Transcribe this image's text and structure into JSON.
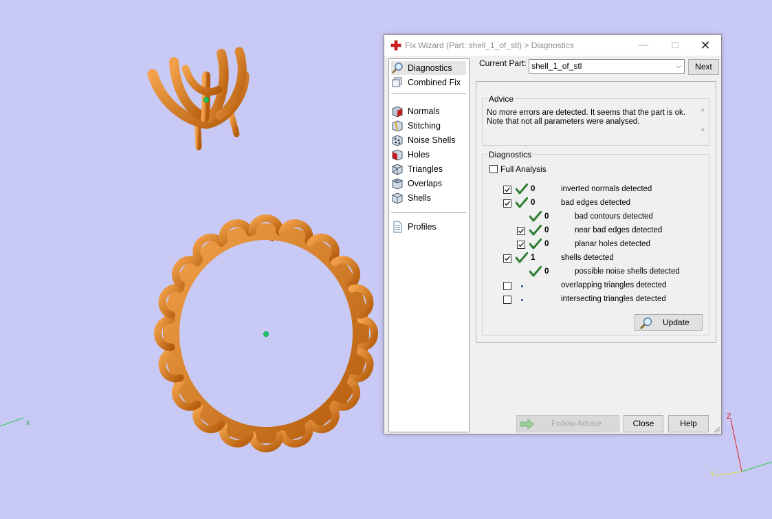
{
  "viewport": {
    "model_color": "#e08020",
    "axis_x_label": "x",
    "axis_z_label": "Z",
    "axis_y_label": "Y"
  },
  "window": {
    "title": "Fix Wizard (Part: shell_1_of_stl) > Diagnostics",
    "minimize": "—",
    "maximize": "□",
    "close": "✕"
  },
  "nav": {
    "items": [
      {
        "label": "Diagnostics",
        "icon": "magnifier-icon",
        "selected": true
      },
      {
        "label": "Combined Fix",
        "icon": "combined-fix-icon"
      },
      {
        "label": "Normals",
        "icon": "normals-icon"
      },
      {
        "label": "Stitching",
        "icon": "stitching-icon"
      },
      {
        "label": "Noise Shells",
        "icon": "noise-shells-icon"
      },
      {
        "label": "Holes",
        "icon": "holes-icon"
      },
      {
        "label": "Triangles",
        "icon": "triangles-icon"
      },
      {
        "label": "Overlaps",
        "icon": "overlaps-icon"
      },
      {
        "label": "Shells",
        "icon": "shells-icon"
      },
      {
        "label": "Profiles",
        "icon": "profiles-icon"
      }
    ]
  },
  "current_part": {
    "label": "Current Part:",
    "value": "shell_1_of_stl",
    "next_label": "Next"
  },
  "advice": {
    "title": "Advice",
    "line1": "No more errors are detected. It seems that the part is ok.",
    "line2": "Note that not all parameters were analysed."
  },
  "diagnostics": {
    "title": "Diagnostics",
    "full_analysis_label": "Full Analysis",
    "full_analysis_checked": false,
    "rows": [
      {
        "checkbox": true,
        "checked": true,
        "status": "ok",
        "count": "0",
        "label": "inverted normals detected",
        "indent": 0
      },
      {
        "checkbox": true,
        "checked": true,
        "status": "ok",
        "count": "0",
        "label": "bad edges detected",
        "indent": 0
      },
      {
        "checkbox": false,
        "checked": false,
        "status": "ok",
        "count": "0",
        "label": "bad contours detected",
        "indent": 1
      },
      {
        "checkbox": true,
        "checked": true,
        "status": "ok",
        "count": "0",
        "label": "near bad edges detected",
        "indent": 1
      },
      {
        "checkbox": true,
        "checked": true,
        "status": "ok",
        "count": "0",
        "label": "planar holes detected",
        "indent": 1
      },
      {
        "checkbox": true,
        "checked": true,
        "status": "ok",
        "count": "1",
        "label": "shells detected",
        "indent": 0
      },
      {
        "checkbox": false,
        "checked": false,
        "status": "ok",
        "count": "0",
        "label": "possible noise shells detected",
        "indent": 1
      },
      {
        "checkbox": true,
        "checked": false,
        "status": "none",
        "count": "",
        "label": "overlapping triangles detected",
        "indent": 0
      },
      {
        "checkbox": true,
        "checked": false,
        "status": "none",
        "count": "",
        "label": "intersecting triangles detected",
        "indent": 0
      }
    ],
    "update_label": "Update"
  },
  "buttons": {
    "follow_advice": "Follow Advice",
    "close": "Close",
    "help": "Help"
  },
  "colors": {
    "ok_check": "#2e7d32",
    "background": "#c9c9f6"
  }
}
